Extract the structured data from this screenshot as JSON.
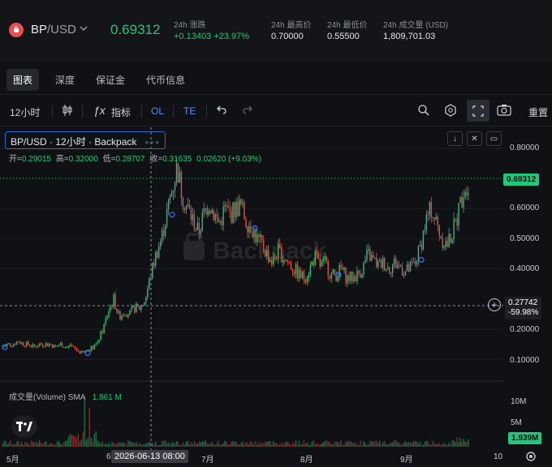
{
  "header": {
    "base": "BP",
    "quote": "/USD",
    "price": "0.69312",
    "stats": [
      {
        "label": "24h 涨跌",
        "value": "+0.13403 +23.97%",
        "green": true
      },
      {
        "label": "24h 最高价",
        "value": "0.70000",
        "green": false
      },
      {
        "label": "24h 最低价",
        "value": "0.55500",
        "green": false
      },
      {
        "label": "24h 成交量 (USD)",
        "value": "1,809,701.03",
        "green": false
      }
    ]
  },
  "tabs": [
    "图表",
    "深度",
    "保证金",
    "代币信息"
  ],
  "toolbar": {
    "interval": "12小时",
    "indicators": "指标",
    "ol": "OL",
    "te": "TE",
    "reset": "重置"
  },
  "legend": {
    "title": "BP/USD · 12小时 · Backpack",
    "more": "∘∘∘",
    "ohlc": {
      "open_label": "开=",
      "open": "0.29015",
      "high_label": "高=",
      "high": "0.32000",
      "low_label": "低=",
      "low": "0.28707",
      "close_label": "收=",
      "close": "0.31635",
      "change": "0.02620 (+9.03%)"
    }
  },
  "volume": {
    "label": "成交量(Volume) SMA",
    "value": "1.861 M"
  },
  "colors": {
    "green": "#21c77a",
    "red": "#e84e4e",
    "accent": "#2a6bd8"
  },
  "chart_data": {
    "type": "candlestick",
    "y_ticks": [
      "0.80000",
      "0.60000",
      "0.50000",
      "0.40000",
      "0.20000",
      "0.10000"
    ],
    "ylim": [
      0.05,
      0.85
    ],
    "x_ticks": [
      "5月",
      "6",
      "7月",
      "8月",
      "9月",
      "10"
    ],
    "last_price": "0.69312",
    "crosshair_price": "0.27742",
    "crosshair_change": "-59.98%",
    "crosshair_date": "2026-06-13  08:00",
    "volume_ticks": [
      "10M",
      "5M"
    ],
    "volume_last": "1.939M",
    "close_path": [
      0.14,
      0.15,
      0.15,
      0.16,
      0.15,
      0.15,
      0.14,
      0.15,
      0.15,
      0.15,
      0.14,
      0.15,
      0.14,
      0.14,
      0.13,
      0.12,
      0.13,
      0.14,
      0.16,
      0.2,
      0.26,
      0.3,
      0.24,
      0.26,
      0.25,
      0.27,
      0.27,
      0.3,
      0.38,
      0.45,
      0.5,
      0.58,
      0.66,
      0.74,
      0.64,
      0.6,
      0.56,
      0.52,
      0.58,
      0.62,
      0.58,
      0.55,
      0.6,
      0.58,
      0.6,
      0.61,
      0.56,
      0.54,
      0.5,
      0.48,
      0.45,
      0.42,
      0.46,
      0.44,
      0.42,
      0.4,
      0.38,
      0.37,
      0.4,
      0.44,
      0.41,
      0.42,
      0.38,
      0.38,
      0.4,
      0.37,
      0.37,
      0.38,
      0.4,
      0.45,
      0.43,
      0.41,
      0.42,
      0.4,
      0.42,
      0.41,
      0.39,
      0.4,
      0.42,
      0.48,
      0.56,
      0.6,
      0.55,
      0.5,
      0.48,
      0.52,
      0.58,
      0.66,
      0.69
    ]
  }
}
